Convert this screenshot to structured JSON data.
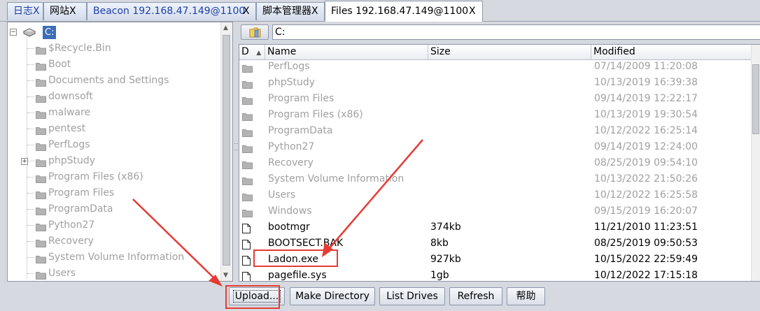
{
  "tabs": [
    {
      "label": "日志",
      "close": "X"
    },
    {
      "label": "网站",
      "close": "X"
    },
    {
      "label": "Beacon 192.168.47.149@1100",
      "close": "X"
    },
    {
      "label": "脚本管理器",
      "close": "X"
    },
    {
      "label": "Files 192.168.47.149@1100",
      "close": "X"
    }
  ],
  "tree": {
    "root": "C:",
    "items": [
      "$Recycle.Bin",
      "Boot",
      "Documents and Settings",
      "downsoft",
      "malware",
      "pentest",
      "PerfLogs",
      "phpStudy",
      "Program Files (x86)",
      "Program Files",
      "ProgramData",
      "Python27",
      "Recovery",
      "System Volume Information",
      "Users"
    ],
    "expander_collapsed": "+",
    "expander_expanded": "−"
  },
  "path": {
    "value": "C:"
  },
  "table": {
    "columns": [
      "D",
      "Name",
      "Size",
      "Modified"
    ],
    "sort_indicator": "▲",
    "rows": [
      {
        "type": "folder",
        "name": "PerfLogs",
        "size": "",
        "modified": "07/14/2009 11:20:08"
      },
      {
        "type": "folder",
        "name": "phpStudy",
        "size": "",
        "modified": "10/13/2019 16:39:38"
      },
      {
        "type": "folder",
        "name": "Program Files",
        "size": "",
        "modified": "09/14/2019 12:22:17"
      },
      {
        "type": "folder",
        "name": "Program Files (x86)",
        "size": "",
        "modified": "10/13/2019 19:30:54"
      },
      {
        "type": "folder",
        "name": "ProgramData",
        "size": "",
        "modified": "10/12/2022 16:25:14"
      },
      {
        "type": "folder",
        "name": "Python27",
        "size": "",
        "modified": "09/14/2019 12:24:00"
      },
      {
        "type": "folder",
        "name": "Recovery",
        "size": "",
        "modified": "08/25/2019 09:54:10"
      },
      {
        "type": "folder",
        "name": "System Volume Information",
        "size": "",
        "modified": "10/13/2022 21:50:26"
      },
      {
        "type": "folder",
        "name": "Users",
        "size": "",
        "modified": "10/12/2022 16:25:58"
      },
      {
        "type": "folder",
        "name": "Windows",
        "size": "",
        "modified": "09/15/2019 16:20:07"
      },
      {
        "type": "file",
        "name": "bootmgr",
        "size": "374kb",
        "modified": "11/21/2010 11:23:51"
      },
      {
        "type": "file",
        "name": "BOOTSECT.BAK",
        "size": "8kb",
        "modified": "08/25/2019 09:50:53"
      },
      {
        "type": "file",
        "name": "Ladon.exe",
        "size": "927kb",
        "modified": "10/15/2022 22:59:49"
      },
      {
        "type": "file",
        "name": "pagefile.sys",
        "size": "1gb",
        "modified": "10/12/2022 17:15:18"
      }
    ]
  },
  "buttons": {
    "upload": "Upload...",
    "make_directory": "Make Directory",
    "list_drives": "List Drives",
    "refresh": "Refresh",
    "help": "帮助"
  },
  "colors": {
    "annotation": "#e53b34",
    "selection": "#3d6fb6",
    "tab_text_blue": "#1f3fa6"
  }
}
